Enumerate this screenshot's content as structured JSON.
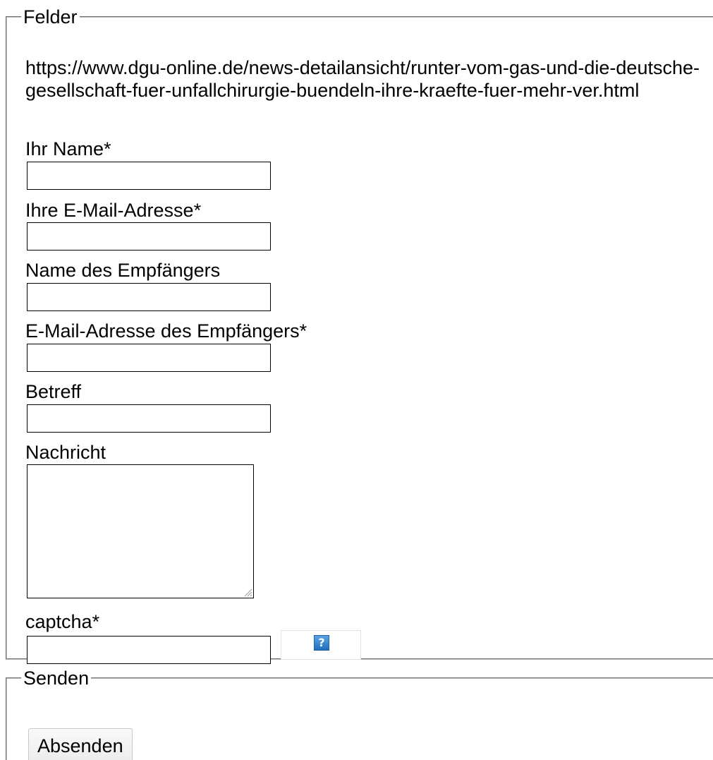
{
  "fieldsets": {
    "fields_legend": "Felder",
    "send_legend": "Senden"
  },
  "page_url": "https://www.dgu-online.de/news-detailansicht/runter-vom-gas-und-die-deutsche-gesellschaft-fuer-unfallchirurgie-buendeln-ihre-kraefte-fuer-mehr-ver.html",
  "form": {
    "sender_name": {
      "label": "Ihr Name*",
      "value": ""
    },
    "sender_email": {
      "label": "Ihre E-Mail-Adresse*",
      "value": ""
    },
    "recipient_name": {
      "label": "Name des Empfängers",
      "value": ""
    },
    "recipient_email": {
      "label": "E-Mail-Adresse des Empfängers*",
      "value": ""
    },
    "subject": {
      "label": "Betreff",
      "value": ""
    },
    "message": {
      "label": "Nachricht",
      "value": ""
    },
    "captcha": {
      "label": "captcha*",
      "value": "",
      "help_glyph": "?"
    }
  },
  "submit": {
    "label": "Absenden"
  },
  "colors": {
    "help_icon": "#1e6fc0",
    "border": "#c0c0c0"
  },
  "icons": {
    "captcha_help": "help-icon",
    "textarea_resize": "resize-grip-icon"
  }
}
